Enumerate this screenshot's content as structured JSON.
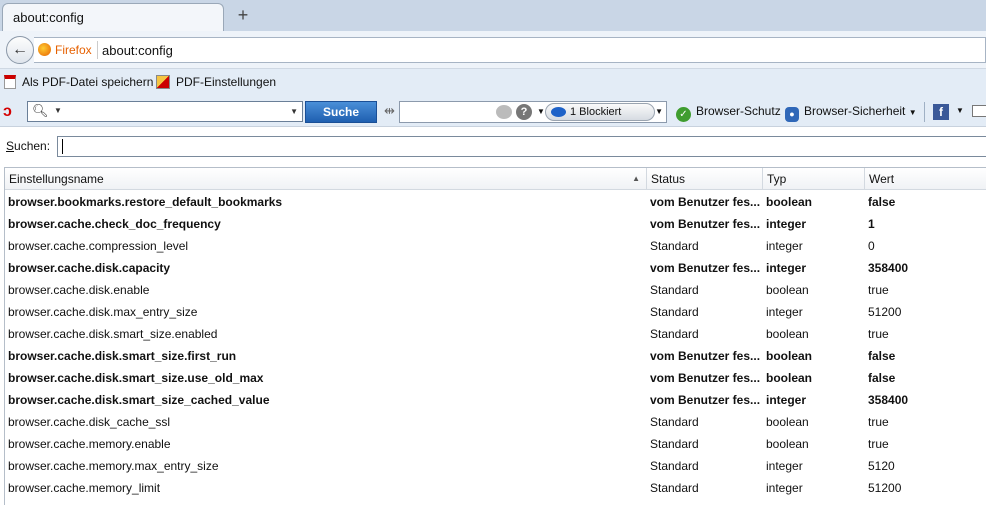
{
  "tab": {
    "title": "about:config",
    "new_tab": "+"
  },
  "nav": {
    "identity": "Firefox",
    "url": "about:config",
    "back": "←"
  },
  "pdfbar": {
    "save_pdf": "Als PDF-Datei speichern",
    "pdf_settings": "PDF-Einstellungen"
  },
  "avira": {
    "search_button": "Suche",
    "blocked": "1 Blockiert",
    "browser_schutz": "Browser-Schutz",
    "browser_sicherheit": "Browser-Sicherheit"
  },
  "search": {
    "label_underline": "S",
    "label_rest": "uchen:",
    "value": ""
  },
  "table": {
    "headers": {
      "name": "Einstellungsname",
      "status": "Status",
      "typ": "Typ",
      "wert": "Wert"
    },
    "rows": [
      {
        "name": "browser.bookmarks.restore_default_bookmarks",
        "status": "vom Benutzer fes...",
        "typ": "boolean",
        "wert": "false",
        "modified": true
      },
      {
        "name": "browser.cache.check_doc_frequency",
        "status": "vom Benutzer fes...",
        "typ": "integer",
        "wert": "1",
        "modified": true
      },
      {
        "name": "browser.cache.compression_level",
        "status": "Standard",
        "typ": "integer",
        "wert": "0",
        "modified": false
      },
      {
        "name": "browser.cache.disk.capacity",
        "status": "vom Benutzer fes...",
        "typ": "integer",
        "wert": "358400",
        "modified": true
      },
      {
        "name": "browser.cache.disk.enable",
        "status": "Standard",
        "typ": "boolean",
        "wert": "true",
        "modified": false
      },
      {
        "name": "browser.cache.disk.max_entry_size",
        "status": "Standard",
        "typ": "integer",
        "wert": "51200",
        "modified": false
      },
      {
        "name": "browser.cache.disk.smart_size.enabled",
        "status": "Standard",
        "typ": "boolean",
        "wert": "true",
        "modified": false
      },
      {
        "name": "browser.cache.disk.smart_size.first_run",
        "status": "vom Benutzer fes...",
        "typ": "boolean",
        "wert": "false",
        "modified": true
      },
      {
        "name": "browser.cache.disk.smart_size.use_old_max",
        "status": "vom Benutzer fes...",
        "typ": "boolean",
        "wert": "false",
        "modified": true
      },
      {
        "name": "browser.cache.disk.smart_size_cached_value",
        "status": "vom Benutzer fes...",
        "typ": "integer",
        "wert": "358400",
        "modified": true
      },
      {
        "name": "browser.cache.disk_cache_ssl",
        "status": "Standard",
        "typ": "boolean",
        "wert": "true",
        "modified": false
      },
      {
        "name": "browser.cache.memory.enable",
        "status": "Standard",
        "typ": "boolean",
        "wert": "true",
        "modified": false
      },
      {
        "name": "browser.cache.memory.max_entry_size",
        "status": "Standard",
        "typ": "integer",
        "wert": "5120",
        "modified": false
      },
      {
        "name": "browser.cache.memory_limit",
        "status": "Standard",
        "typ": "integer",
        "wert": "51200",
        "modified": false
      }
    ]
  }
}
